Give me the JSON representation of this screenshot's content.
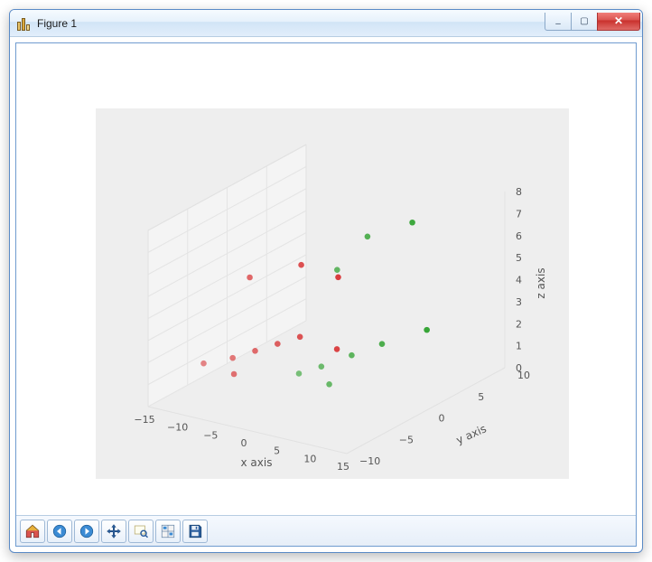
{
  "window": {
    "title": "Figure 1",
    "controls": {
      "minimize": "–",
      "maximize": "▢",
      "close": "✕"
    }
  },
  "toolbar": {
    "items": [
      {
        "name": "home-icon",
        "tip": "Reset original view"
      },
      {
        "name": "back-icon",
        "tip": "Back to previous view"
      },
      {
        "name": "forward-icon",
        "tip": "Forward to next view"
      },
      {
        "name": "pan-icon",
        "tip": "Pan axes"
      },
      {
        "name": "zoom-icon",
        "tip": "Zoom to rectangle"
      },
      {
        "name": "subplots-icon",
        "tip": "Configure subplots"
      },
      {
        "name": "save-icon",
        "tip": "Save the figure"
      }
    ]
  },
  "chart_data": {
    "type": "scatter",
    "projection": "3d",
    "xlabel": "x axis",
    "ylabel": "y axis",
    "zlabel": "z axis",
    "xlim": [
      -15,
      15
    ],
    "ylim": [
      -10,
      10
    ],
    "zlim": [
      0,
      8
    ],
    "xticks": [
      -15,
      -10,
      -5,
      0,
      5,
      10,
      15
    ],
    "yticks": [
      -10,
      -5,
      0,
      5,
      10
    ],
    "zticks": [
      0,
      1,
      2,
      3,
      4,
      5,
      6,
      7,
      8
    ],
    "series": [
      {
        "name": "red",
        "color": "#d62728",
        "points": [
          {
            "x": -8,
            "y": -3,
            "z": 5
          },
          {
            "x": -5,
            "y": 1,
            "z": 5
          },
          {
            "x": -3,
            "y": 4,
            "z": 4
          },
          {
            "x": -7,
            "y": -6,
            "z": 2
          },
          {
            "x": -6,
            "y": -4,
            "z": 2
          },
          {
            "x": -5,
            "y": -2,
            "z": 2
          },
          {
            "x": -4,
            "y": 0,
            "z": 2
          },
          {
            "x": -2,
            "y": 3,
            "z": 1
          },
          {
            "x": -9,
            "y": -8,
            "z": 2
          },
          {
            "x": -8,
            "y": -5,
            "z": 1
          }
        ]
      },
      {
        "name": "green",
        "color": "#2ca02c",
        "points": [
          {
            "x": 5,
            "y": 1,
            "z": 7
          },
          {
            "x": 7,
            "y": 5,
            "z": 7
          },
          {
            "x": 4,
            "y": -2,
            "z": 6
          },
          {
            "x": 4,
            "y": -4,
            "z": 2
          },
          {
            "x": 5,
            "y": -1,
            "z": 2
          },
          {
            "x": 6,
            "y": 2,
            "z": 2
          },
          {
            "x": 8,
            "y": 6,
            "z": 2
          },
          {
            "x": 3,
            "y": -6,
            "z": 2
          },
          {
            "x": 4,
            "y": -3,
            "z": 1
          }
        ]
      }
    ]
  }
}
